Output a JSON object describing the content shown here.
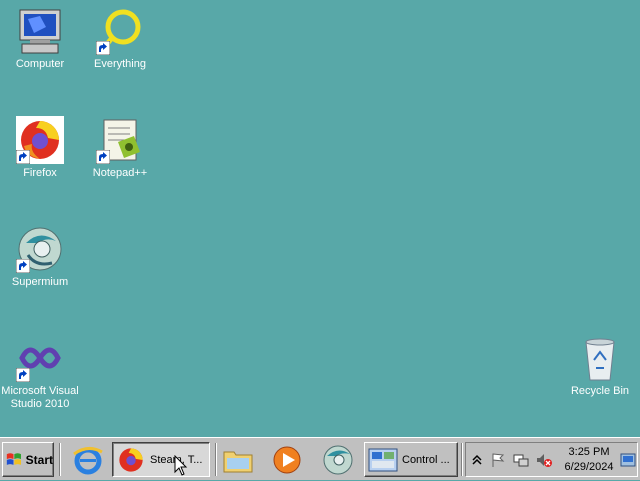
{
  "desktop": {
    "icons": [
      {
        "label": "Computer",
        "icon": "computer-icon"
      },
      {
        "label": "Everything",
        "icon": "everything-icon"
      },
      {
        "label": "Firefox",
        "icon": "firefox-icon"
      },
      {
        "label": "Notepad++",
        "icon": "notepadpp-icon"
      },
      {
        "label": "Supermium",
        "icon": "supermium-icon"
      },
      {
        "label": "Microsoft Visual Studio 2010",
        "icon": "visual-studio-icon"
      },
      {
        "label": "Recycle Bin",
        "icon": "recycle-bin-icon"
      }
    ],
    "background_color": "#58a8a8"
  },
  "taskbar": {
    "start_label": "Start",
    "quick_launch": [
      {
        "icon": "internet-explorer-icon"
      }
    ],
    "tasks": [
      {
        "label": "Steam, T...",
        "icon": "firefox-icon",
        "active": true
      },
      {
        "label": "",
        "icon": "folder-icon"
      },
      {
        "label": "",
        "icon": "media-player-icon"
      },
      {
        "label": "",
        "icon": "supermium-icon"
      },
      {
        "label": "Control ...",
        "icon": "control-panel-icon"
      }
    ],
    "tray": {
      "icons": [
        "chevron-up-icon",
        "flag-icon",
        "network-icon",
        "volume-muted-icon"
      ],
      "time": "3:25 PM",
      "date": "6/29/2024"
    }
  }
}
